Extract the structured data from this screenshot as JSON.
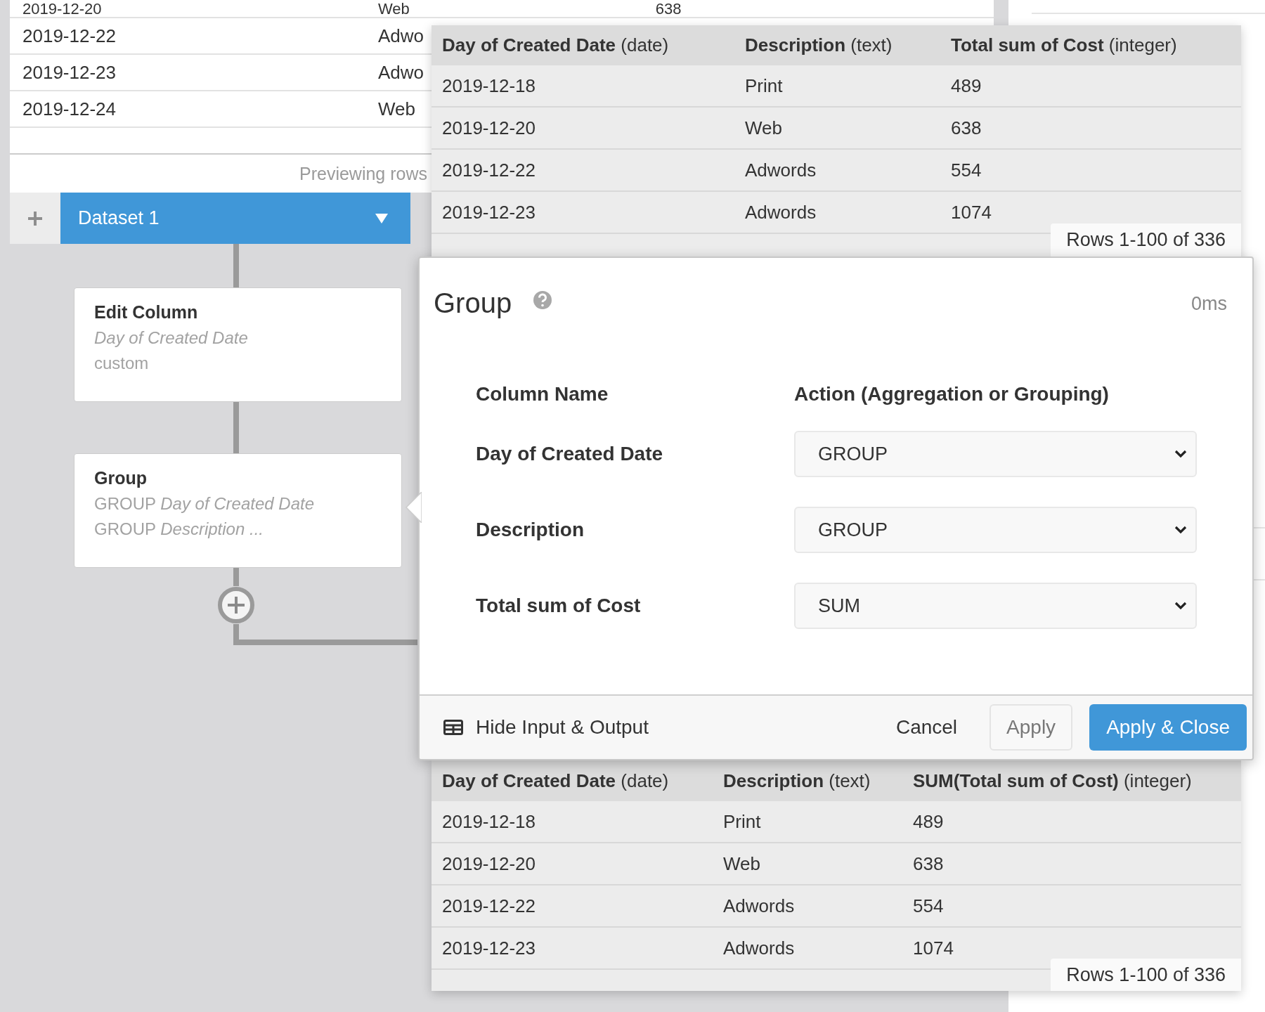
{
  "background_table": {
    "rows": [
      {
        "cells": [
          "2019-12-20",
          "Web",
          "638"
        ]
      },
      {
        "cells": [
          "2019-12-22",
          "Adwo"
        ]
      },
      {
        "cells": [
          "2019-12-23",
          "Adwo"
        ]
      },
      {
        "cells": [
          "2019-12-24",
          "Web"
        ]
      }
    ],
    "footer": "Previewing rows"
  },
  "tab_bar": {
    "tabs": [
      {
        "label": "Dataset 1",
        "selected": true
      }
    ]
  },
  "steps": [
    {
      "title": "Edit Column",
      "lines": [
        "*Day of Created Date*",
        "custom"
      ]
    },
    {
      "title": "Group",
      "lines": [
        "GROUP *Day of Created Date*",
        "GROUP *Description ...*"
      ]
    }
  ],
  "input_table": {
    "columns": [
      {
        "name": "Day of Created Date",
        "type": "(date)"
      },
      {
        "name": "Description",
        "type": "(text)"
      },
      {
        "name": "Total sum of Cost",
        "type": "(integer)"
      }
    ],
    "rows": [
      [
        "2019-12-18",
        "Print",
        "489"
      ],
      [
        "2019-12-20",
        "Web",
        "638"
      ],
      [
        "2019-12-22",
        "Adwords",
        "554"
      ],
      [
        "2019-12-23",
        "Adwords",
        "1074"
      ]
    ],
    "row_count": "Rows 1-100 of 336"
  },
  "modal": {
    "title": "Group",
    "duration": "0ms",
    "column_headers": [
      "Column Name",
      "Action (Aggregation or Grouping)"
    ],
    "fields": [
      {
        "name": "Day of Created Date",
        "value": "GROUP"
      },
      {
        "name": "Description",
        "value": "GROUP"
      },
      {
        "name": "Total sum of Cost",
        "value": "SUM"
      }
    ],
    "toggle": "Hide Input & Output",
    "buttons": [
      {
        "label": "Cancel",
        "kind": "link"
      },
      {
        "label": "Apply",
        "kind": "secondary"
      },
      {
        "label": "Apply & Close",
        "kind": "primary"
      }
    ]
  },
  "output_table": {
    "columns": [
      {
        "name": "Day of Created Date",
        "type": "(date)"
      },
      {
        "name": "Description",
        "type": "(text)"
      },
      {
        "name": "SUM(Total sum of Cost)",
        "type": "(integer)"
      }
    ],
    "rows": [
      [
        "2019-12-18",
        "Print",
        "489"
      ],
      [
        "2019-12-20",
        "Web",
        "638"
      ],
      [
        "2019-12-22",
        "Adwords",
        "554"
      ],
      [
        "2019-12-23",
        "Adwords",
        "1074"
      ]
    ],
    "row_count": "Rows 1-100 of 336"
  }
}
